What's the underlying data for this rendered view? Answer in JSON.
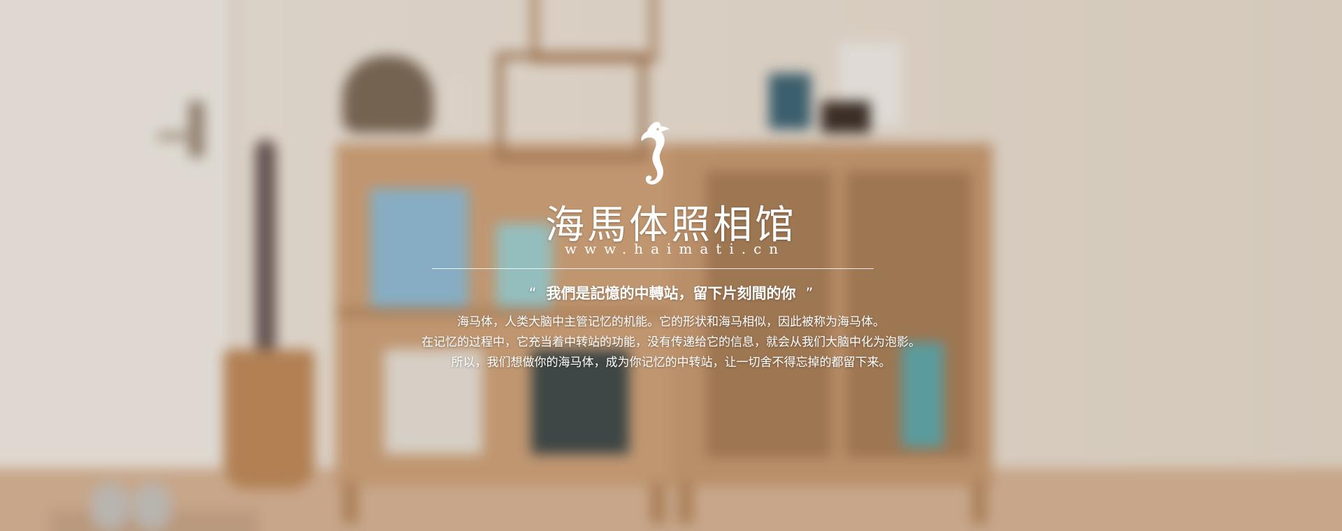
{
  "brand": {
    "logo_icon": "seahorse-icon",
    "name": "海馬体照相馆",
    "domain": "www.haimati.cn"
  },
  "slogan": {
    "open_quote": "“",
    "text": "我們是記憶的中轉站，留下片刻間的你",
    "close_quote": "”"
  },
  "description": {
    "line1": "海马体，人类大脑中主管记忆的机能。它的形状和海马相似，因此被称为海马体。",
    "line2": "在记忆的过程中，它充当着中转站的功能，没有传递给它的信息，就会从我们大脑中化为泡影。",
    "line3": "所以，我们想做你的海马体，成为你记忆的中转站，让一切舍不得忘掉的都留下来。"
  },
  "colors": {
    "text": "#ffffff",
    "wall": "#ebe2d6",
    "wood": "#cfa37a"
  }
}
